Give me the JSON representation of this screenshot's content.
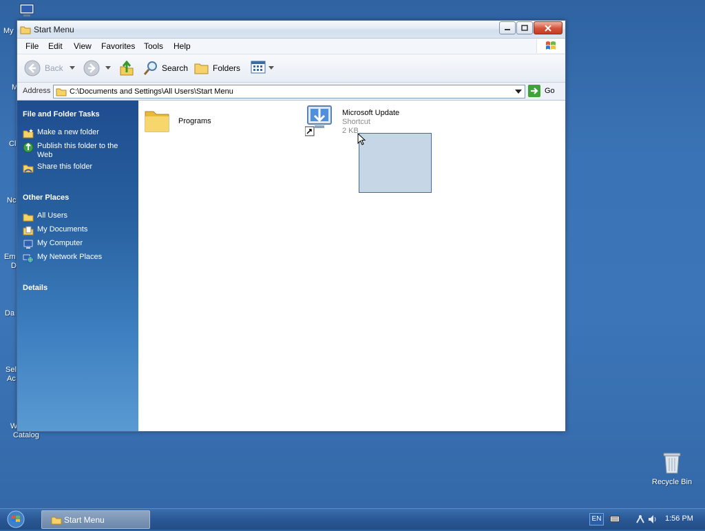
{
  "desktop": {
    "partial_labels": [
      "My",
      "M",
      "Cl",
      "Nc",
      "Em",
      "D",
      "Da",
      "Sel",
      "Ac",
      "W",
      "Catalog"
    ],
    "recycle_bin_label": "Recycle Bin"
  },
  "window": {
    "title": "Start Menu",
    "menu": [
      "File",
      "Edit",
      "View",
      "Favorites",
      "Tools",
      "Help"
    ],
    "toolbar": {
      "back_label": "Back",
      "search_label": "Search",
      "folders_label": "Folders"
    },
    "address": {
      "label": "Address",
      "value": "C:\\Documents and Settings\\All Users\\Start Menu",
      "go_label": "Go"
    },
    "tasks": {
      "file_folder_title": "File and Folder Tasks",
      "file_folder_items": [
        "Make a new folder",
        "Publish this folder to the Web",
        "Share this folder"
      ],
      "other_places_title": "Other Places",
      "other_places_items": [
        "All Users",
        "My Documents",
        "My Computer",
        "My Network Places"
      ],
      "details_title": "Details"
    },
    "items": [
      {
        "name": "Programs",
        "type": "folder"
      },
      {
        "name": "Microsoft Update",
        "kind": "Shortcut",
        "size": "2 KB",
        "type": "shortcut"
      }
    ]
  },
  "taskbar": {
    "task_label": "Start Menu",
    "language": "EN",
    "clock": "1:56 PM"
  },
  "colors": {
    "accent": "#2a5895",
    "task_pane_blue": "#28609f",
    "selection": "#c6d6e7"
  }
}
